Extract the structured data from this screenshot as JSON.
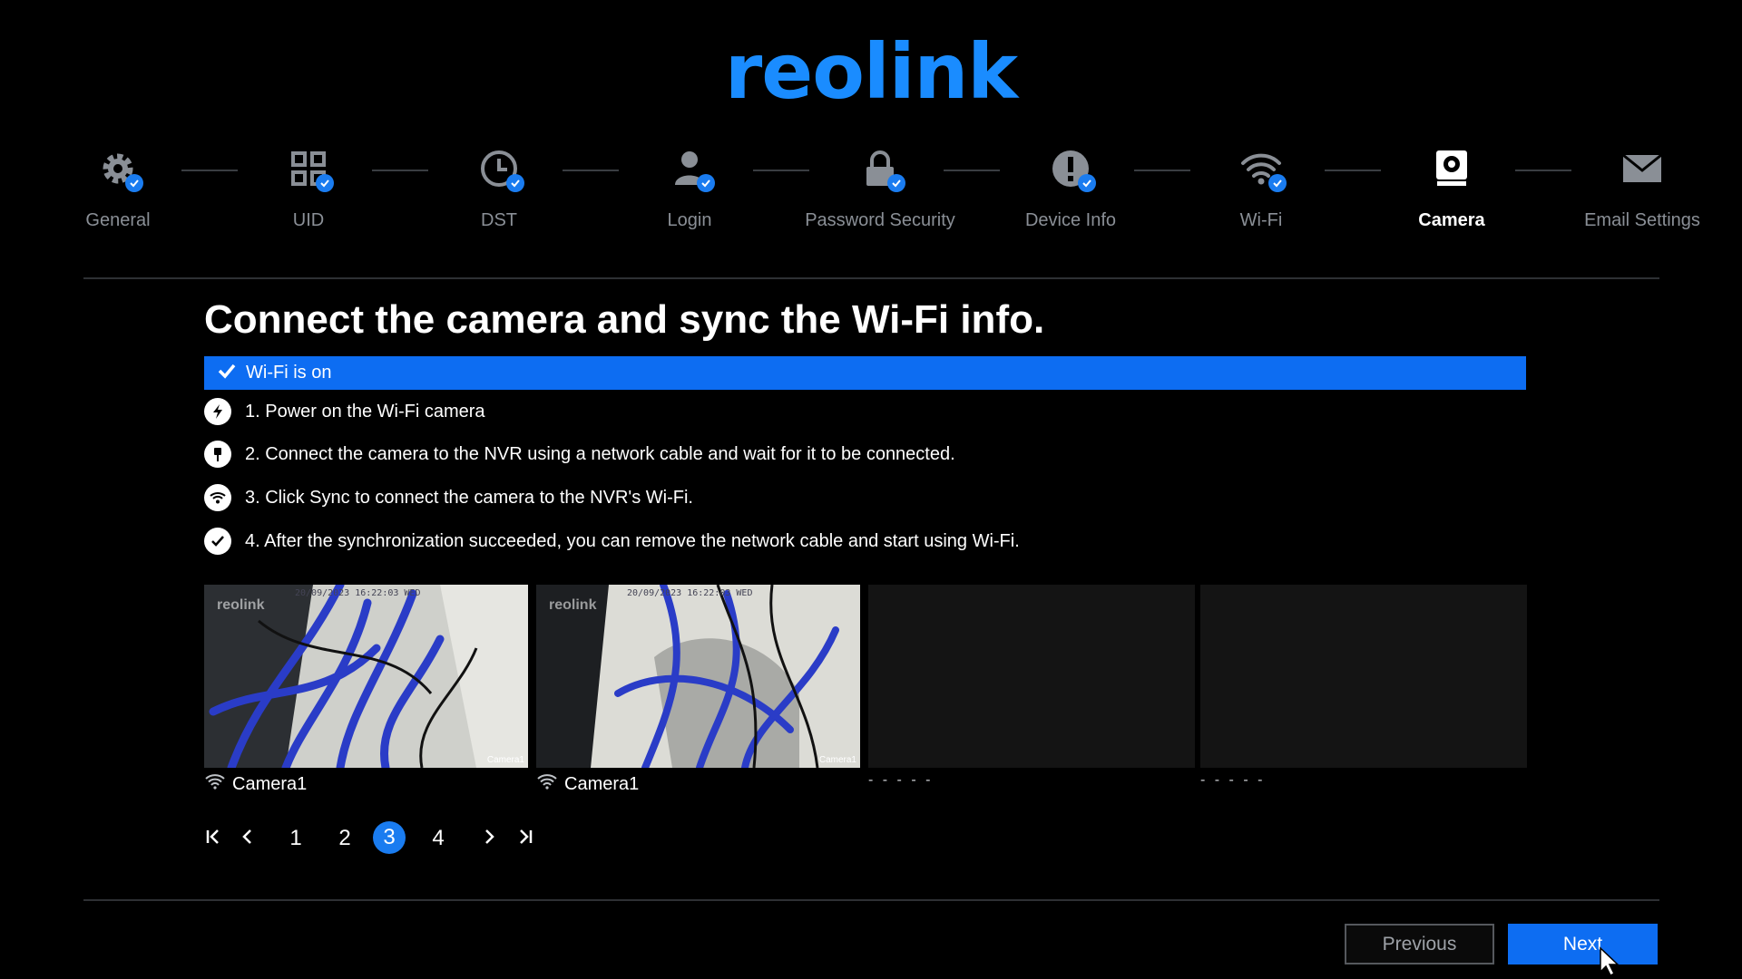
{
  "brand": {
    "logo_text": "reolink",
    "accent": "#1a8cff",
    "primary_blue": "#0d6df2"
  },
  "steps": [
    {
      "label": "General",
      "icon": "gear-icon",
      "done": true,
      "active": false
    },
    {
      "label": "UID",
      "icon": "grid-icon",
      "done": true,
      "active": false
    },
    {
      "label": "DST",
      "icon": "clock-icon",
      "done": true,
      "active": false
    },
    {
      "label": "Login",
      "icon": "user-icon",
      "done": true,
      "active": false
    },
    {
      "label": "Password Security",
      "icon": "lock-icon",
      "done": true,
      "active": false
    },
    {
      "label": "Device Info",
      "icon": "info-alert-icon",
      "done": true,
      "active": false
    },
    {
      "label": "Wi-Fi",
      "icon": "wifi-icon",
      "done": true,
      "active": false
    },
    {
      "label": "Camera",
      "icon": "camera-icon",
      "done": false,
      "active": true
    },
    {
      "label": "Email Settings",
      "icon": "mail-icon",
      "done": false,
      "active": false
    }
  ],
  "main": {
    "title": "Connect the camera and sync the Wi-Fi info.",
    "banner": "Wi-Fi is on",
    "instructions": [
      {
        "text": "1. Power on the Wi-Fi camera",
        "icon": "power-bolt-icon"
      },
      {
        "text": "2. Connect the camera to the NVR using a network cable and wait for it to be connected.",
        "icon": "cable-plug-icon"
      },
      {
        "text": "3. Click Sync to connect the camera to the NVR's Wi-Fi.",
        "icon": "wifi-sync-icon"
      },
      {
        "text": "4. After the synchronization succeeded, you can remove the network cable and start using Wi-Fi.",
        "icon": "check-circle-icon"
      }
    ]
  },
  "cameras": [
    {
      "name": "Camera1",
      "has_feed": true,
      "timestamp": "20/09/2023 16:22:03 WED",
      "watermark": "reolink",
      "overlay_label": "Camera1"
    },
    {
      "name": "Camera1",
      "has_feed": true,
      "timestamp": "20/09/2023 16:22:03 WED",
      "watermark": "reolink",
      "overlay_label": "Camera1"
    },
    {
      "name": "- - - - -",
      "has_feed": false
    },
    {
      "name": "- - - - -",
      "has_feed": false
    }
  ],
  "pagination": {
    "pages": [
      "1",
      "2",
      "3",
      "4"
    ],
    "current": "3"
  },
  "footer": {
    "previous_label": "Previous",
    "next_label": "Next"
  }
}
